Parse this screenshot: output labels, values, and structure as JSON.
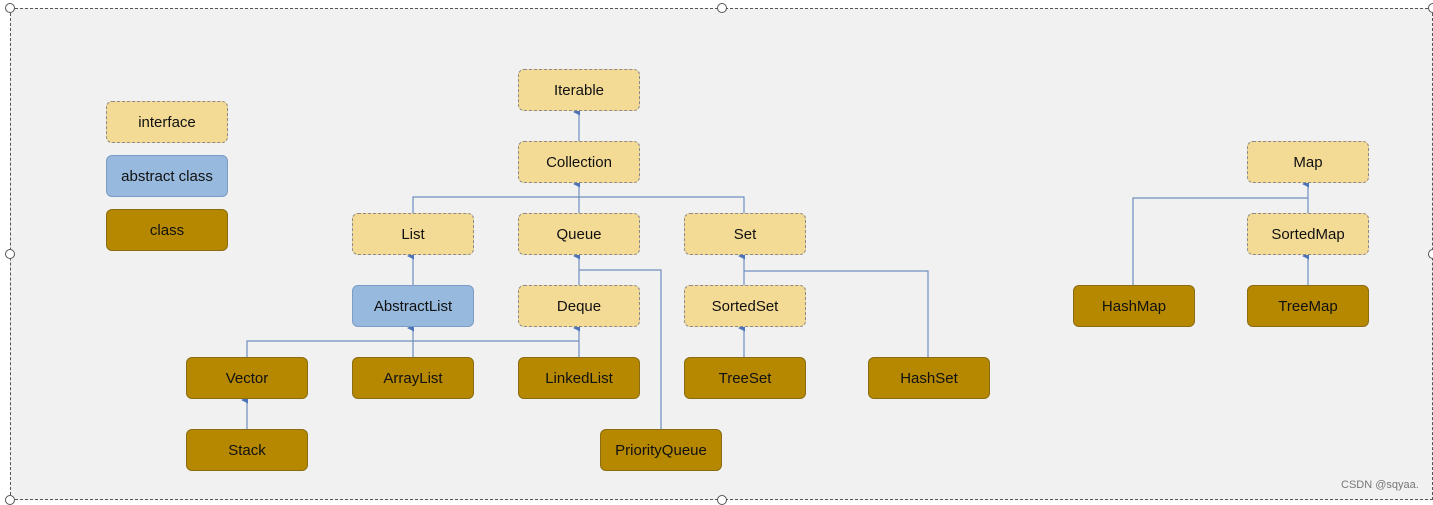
{
  "legend": {
    "interface": "interface",
    "abstract": "abstract class",
    "class": "class"
  },
  "nodes": {
    "iterable": "Iterable",
    "collection": "Collection",
    "list": "List",
    "queue": "Queue",
    "set": "Set",
    "abstractlist": "AbstractList",
    "deque": "Deque",
    "sortedset": "SortedSet",
    "vector": "Vector",
    "arraylist": "ArrayList",
    "linkedlist": "LinkedList",
    "treeset": "TreeSet",
    "hashset": "HashSet",
    "stack": "Stack",
    "priorityqueue": "PriorityQueue",
    "map": "Map",
    "sortedmap": "SortedMap",
    "hashmap": "HashMap",
    "treemap": "TreeMap"
  },
  "colors": {
    "interface": "#f3da95",
    "abstract": "#97b9dd",
    "class": "#b58800",
    "connector": "#6f8fbf"
  },
  "watermark": "CSDN @sqyaa."
}
